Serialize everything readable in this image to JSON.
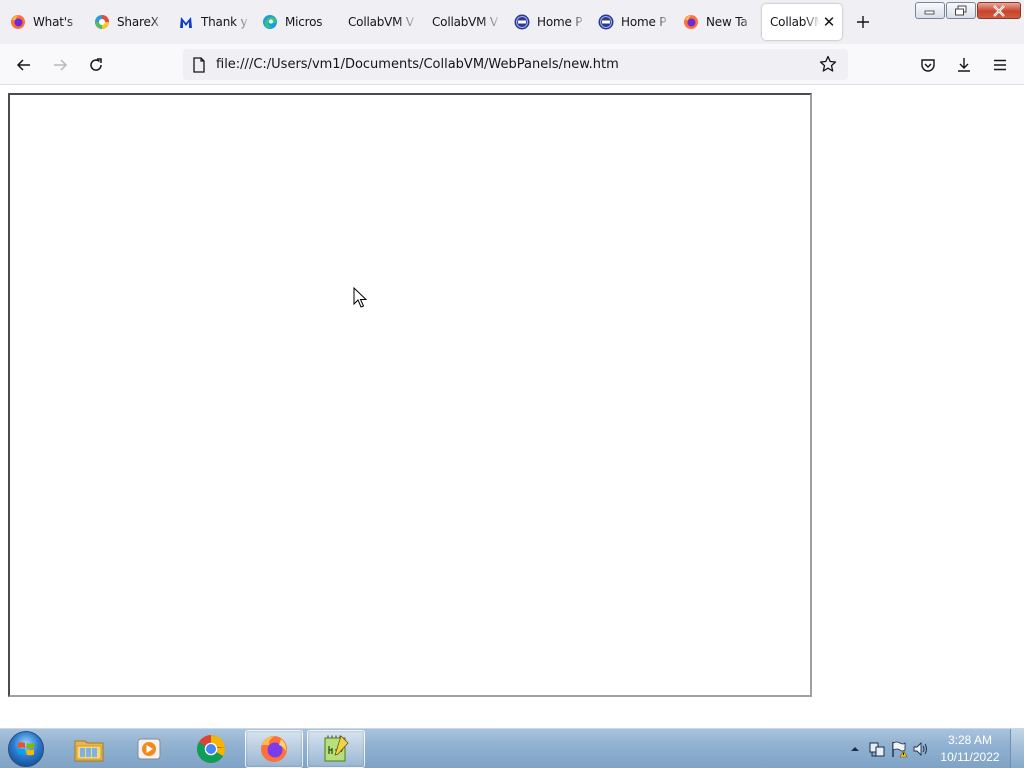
{
  "browser": {
    "tabs": [
      {
        "title": "What's",
        "icon": "firefox-icon",
        "active": false
      },
      {
        "title": "ShareX",
        "icon": "sharex-icon",
        "active": false
      },
      {
        "title": "Thank y",
        "icon": "malwarebytes-icon",
        "active": false
      },
      {
        "title": "Micros",
        "icon": "edge-icon",
        "active": false
      },
      {
        "title": "CollabVM V",
        "icon": "",
        "active": false
      },
      {
        "title": "CollabVM V",
        "icon": "",
        "active": false
      },
      {
        "title": "Home P",
        "icon": "pre-icon",
        "active": false
      },
      {
        "title": "Home P",
        "icon": "pre-icon",
        "active": false
      },
      {
        "title": "New Ta",
        "icon": "firefox-icon",
        "active": false
      },
      {
        "title": "CollabVM",
        "icon": "",
        "active": true
      }
    ],
    "url": "file:///C:/Users/vm1/Documents/CollabVM/WebPanels/new.htm"
  },
  "taskbar": {
    "pinned": [
      "windows-explorer-icon",
      "media-player-icon",
      "chrome-icon",
      "firefox-icon",
      "notepad-plus-plus-icon"
    ],
    "clock_time": "3:28 AM",
    "clock_date": "10/11/2022"
  },
  "colors": {
    "tab_strip": "#f0f0f4",
    "nav_bar": "#f9f9fb",
    "taskbar": "#8fb0d0"
  }
}
